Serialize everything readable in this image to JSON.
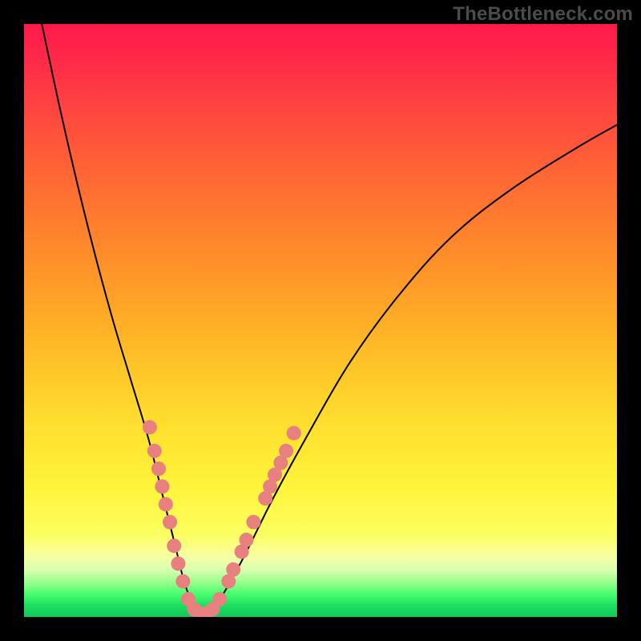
{
  "watermark": "TheBottleneck.com",
  "colors": {
    "background": "#000000",
    "dot": "#e98080",
    "curve": "#000000"
  },
  "chart_data": {
    "type": "line",
    "title": "",
    "xlabel": "",
    "ylabel": "",
    "xlim": [
      0,
      100
    ],
    "ylim": [
      0,
      100
    ],
    "grid": false,
    "legend": false,
    "annotations": [
      "TheBottleneck.com"
    ],
    "series": [
      {
        "name": "bottleneck-curve",
        "x": [
          3,
          6,
          9,
          12,
          15,
          18,
          21,
          23.5,
          25.5,
          27,
          28.5,
          30,
          33,
          37,
          42,
          48,
          55,
          63,
          72,
          82,
          93,
          100
        ],
        "y": [
          100,
          86,
          73,
          61,
          50,
          40,
          30,
          20,
          12,
          6,
          2,
          0,
          3,
          10,
          20,
          31,
          43,
          54,
          64,
          72,
          79,
          83
        ]
      }
    ],
    "scatter_points": {
      "name": "highlight-dots",
      "approx": true,
      "points": [
        {
          "x": 21.2,
          "y": 32
        },
        {
          "x": 22.0,
          "y": 28
        },
        {
          "x": 22.7,
          "y": 25
        },
        {
          "x": 23.3,
          "y": 22
        },
        {
          "x": 23.9,
          "y": 19
        },
        {
          "x": 24.6,
          "y": 16
        },
        {
          "x": 25.3,
          "y": 12
        },
        {
          "x": 26.0,
          "y": 9
        },
        {
          "x": 26.8,
          "y": 6
        },
        {
          "x": 27.7,
          "y": 3
        },
        {
          "x": 28.7,
          "y": 1.3
        },
        {
          "x": 29.7,
          "y": 0.6
        },
        {
          "x": 30.8,
          "y": 0.6
        },
        {
          "x": 31.8,
          "y": 1.3
        },
        {
          "x": 33.0,
          "y": 3
        },
        {
          "x": 34.5,
          "y": 6
        },
        {
          "x": 35.3,
          "y": 8
        },
        {
          "x": 36.7,
          "y": 11
        },
        {
          "x": 37.5,
          "y": 13
        },
        {
          "x": 38.7,
          "y": 16
        },
        {
          "x": 40.7,
          "y": 20
        },
        {
          "x": 41.5,
          "y": 22
        },
        {
          "x": 42.3,
          "y": 24
        },
        {
          "x": 43.3,
          "y": 26
        },
        {
          "x": 44.2,
          "y": 28
        },
        {
          "x": 45.5,
          "y": 31
        }
      ]
    }
  }
}
